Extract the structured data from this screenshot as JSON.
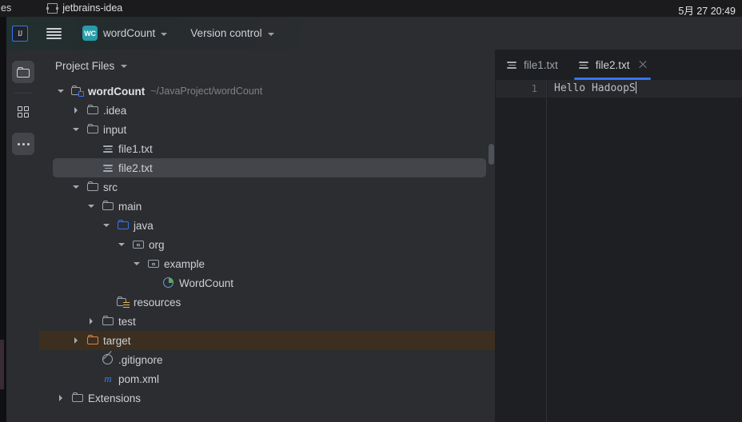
{
  "os_bar": {
    "left_text": "es",
    "app_title": "jetbrains-idea",
    "app_icon": "ij-mini-icon",
    "clock": "5月 27  20:49"
  },
  "toolbar": {
    "logo": "IJ",
    "logo_icon": "intellij-logo-icon",
    "menu_icon": "hamburger-menu-icon",
    "project_badge": "WC",
    "project_name": "wordCount",
    "vcs_label": "Version control",
    "chevron_icon": "chevron-down-icon"
  },
  "activity_bar": {
    "items": [
      {
        "name": "project-files",
        "icon": "folder-icon",
        "selected": true
      },
      {
        "name": "structure",
        "icon": "grid-icon",
        "selected": false
      },
      {
        "name": "more-tool-windows",
        "icon": "more-dots-icon",
        "selected": true
      }
    ]
  },
  "tool_window": {
    "title": "Project Files",
    "chevron_icon": "chevron-down-icon",
    "tree": [
      {
        "label": "wordCount",
        "hint": "~/JavaProject/wordCount",
        "icon": "module-icon",
        "arrow": "down",
        "indent": 0,
        "bold": true,
        "state": "normal"
      },
      {
        "label": ".idea",
        "hint": "",
        "icon": "folder-icon",
        "arrow": "right",
        "indent": 1,
        "bold": false,
        "state": "normal"
      },
      {
        "label": "input",
        "hint": "",
        "icon": "folder-icon",
        "arrow": "down",
        "indent": 1,
        "bold": false,
        "state": "normal"
      },
      {
        "label": "file1.txt",
        "hint": "",
        "icon": "text-file-icon",
        "arrow": "none",
        "indent": 2,
        "bold": false,
        "state": "normal"
      },
      {
        "label": "file2.txt",
        "hint": "",
        "icon": "text-file-icon",
        "arrow": "none",
        "indent": 2,
        "bold": false,
        "state": "selected"
      },
      {
        "label": "src",
        "hint": "",
        "icon": "folder-icon",
        "arrow": "down",
        "indent": 1,
        "bold": false,
        "state": "normal"
      },
      {
        "label": "main",
        "hint": "",
        "icon": "folder-icon",
        "arrow": "down",
        "indent": 2,
        "bold": false,
        "state": "normal"
      },
      {
        "label": "java",
        "hint": "",
        "icon": "source-root-folder-icon",
        "arrow": "down",
        "indent": 3,
        "bold": false,
        "state": "normal"
      },
      {
        "label": "org",
        "hint": "",
        "icon": "package-icon",
        "arrow": "down",
        "indent": 4,
        "bold": false,
        "state": "normal"
      },
      {
        "label": "example",
        "hint": "",
        "icon": "package-icon",
        "arrow": "down",
        "indent": 5,
        "bold": false,
        "state": "normal"
      },
      {
        "label": "WordCount",
        "hint": "",
        "icon": "java-class-icon",
        "arrow": "none",
        "indent": 6,
        "bold": false,
        "state": "normal"
      },
      {
        "label": "resources",
        "hint": "",
        "icon": "resources-folder-icon",
        "arrow": "none",
        "indent": 3,
        "bold": false,
        "state": "normal"
      },
      {
        "label": "test",
        "hint": "",
        "icon": "folder-icon",
        "arrow": "right",
        "indent": 2,
        "bold": false,
        "state": "normal"
      },
      {
        "label": "target",
        "hint": "",
        "icon": "excluded-folder-icon",
        "arrow": "right",
        "indent": 1,
        "bold": false,
        "state": "excluded"
      },
      {
        "label": ".gitignore",
        "hint": "",
        "icon": "gitignore-icon",
        "arrow": "none",
        "indent": 2,
        "bold": false,
        "state": "normal"
      },
      {
        "label": "pom.xml",
        "hint": "",
        "icon": "maven-icon",
        "arrow": "none",
        "indent": 2,
        "bold": false,
        "state": "normal"
      },
      {
        "label": "Extensions",
        "hint": "",
        "icon": "folder-icon",
        "arrow": "right",
        "indent": 0,
        "bold": false,
        "state": "normal"
      }
    ]
  },
  "editor": {
    "tabs": [
      {
        "label": "file1.txt",
        "icon": "text-file-icon",
        "active": false,
        "closable": false
      },
      {
        "label": "file2.txt",
        "icon": "text-file-icon",
        "active": true,
        "closable": true
      }
    ],
    "close_icon": "close-icon",
    "lines": [
      {
        "number": "1",
        "text": "Hello HadoopS"
      }
    ]
  },
  "colors": {
    "accent_blue": "#3574f0",
    "panel_bg": "#2b2d30",
    "editor_bg": "#1e1f22",
    "selection": "#43454a",
    "excluded": "#3c2f1f",
    "module_teal": "#279daa"
  }
}
